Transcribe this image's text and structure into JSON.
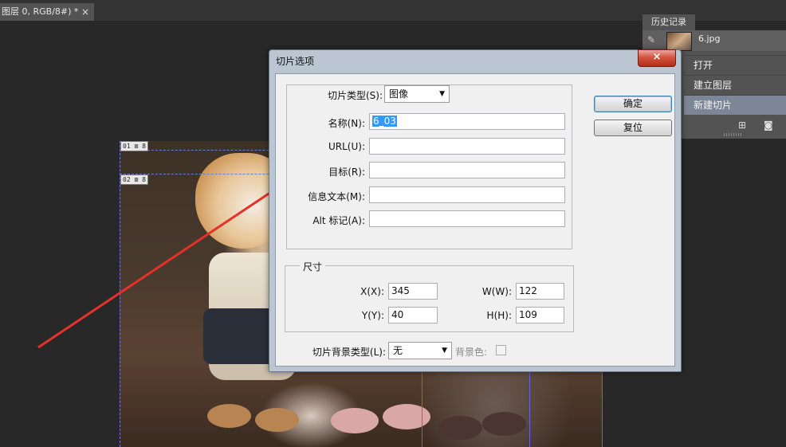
{
  "document_tab": {
    "title": "图层 0, RGB/8#) *",
    "close": "×"
  },
  "slice_badges": [
    "01",
    "02"
  ],
  "history": {
    "tab": "历史记录",
    "snapshot": "6.jpg",
    "items": [
      {
        "label": "打开",
        "selected": false
      },
      {
        "label": "建立图层",
        "selected": false
      },
      {
        "label": "新建切片",
        "selected": true
      }
    ]
  },
  "dialog": {
    "title": "切片选项",
    "close": "×",
    "slice_type_label": "切片类型(S):",
    "slice_type_value": "图像",
    "name_label": "名称(N):",
    "name_value": "6_03",
    "url_label": "URL(U):",
    "url_value": "",
    "target_label": "目标(R):",
    "target_value": "",
    "message_label": "信息文本(M):",
    "message_value": "",
    "alt_label": "Alt 标记(A):",
    "alt_value": "",
    "ok": "确定",
    "reset": "复位",
    "dimensions_legend": "尺寸",
    "x_label": "X(X):",
    "x_value": "345",
    "y_label": "Y(Y):",
    "y_value": "40",
    "w_label": "W(W):",
    "w_value": "122",
    "h_label": "H(H):",
    "h_value": "109",
    "bg_type_label": "切片背景类型(L):",
    "bg_type_value": "无",
    "bg_color_label": "背景色:"
  },
  "colors": {
    "arrow": "#e8302a",
    "selection": "#3399ff",
    "history_selected": "#7d8697"
  }
}
